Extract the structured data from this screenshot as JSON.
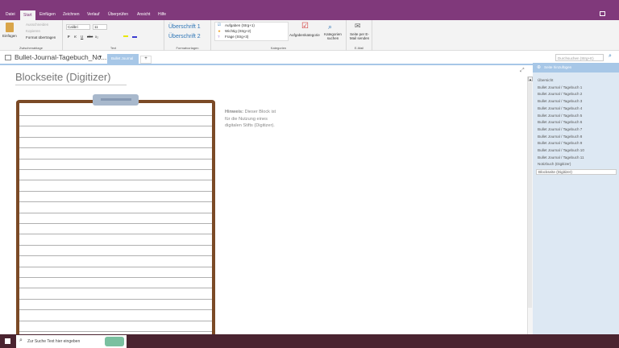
{
  "ribbon_tabs": [
    "Datei",
    "Start",
    "Einfügen",
    "Zeichnen",
    "Verlauf",
    "Überprüfen",
    "Ansicht",
    "Hilfe"
  ],
  "active_tab": "Start",
  "clipboard": {
    "paste": "Einfügen",
    "cut": "Ausschneiden",
    "copy": "Kopieren",
    "format_painter": "Format übertragen",
    "label": "Zwischenablage"
  },
  "text": {
    "font": "Calibri",
    "size": "11",
    "bold": "F",
    "italic": "K",
    "underline": "U",
    "strike": "abc",
    "sub": "x₂",
    "label": "Text"
  },
  "styles": {
    "h1": "Überschrift 1",
    "h2": "Überschrift 2",
    "label": "Formatvorlagen"
  },
  "tags": {
    "items": [
      "Aufgaben (Strg+1)",
      "Wichtig (Strg+2)",
      "Frage (Strg+3)"
    ],
    "todo_tag": "Aufgabenkategorie",
    "find_tags": "Kategorien suchen",
    "label": "Kategorien"
  },
  "email": {
    "send": "Seite per E-Mail senden",
    "label": "E-Mail"
  },
  "notebook": {
    "name": "Bullet-Journal-Tagebuch_No...",
    "section_tab": "Bullet Journal",
    "add_tab": "+"
  },
  "search": {
    "placeholder": "Durchsuchen (Strg+E)"
  },
  "page": {
    "title": "Blockseite (Digitizer)",
    "hint_bold": "Hinweis:",
    "hint_text": " Dieser Block ist für die Nutzung eines digitalen Stifts (Digitizer)."
  },
  "pages_panel": {
    "add_page": "Seite hinzufügen",
    "items": [
      "Übersicht",
      "Bullet Journal / Tagebuch 1",
      "Bullet Journal / Tagebuch 2",
      "Bullet Journal / Tagebuch 3",
      "Bullet Journal / Tagebuch 4",
      "Bullet Journal / Tagebuch 5",
      "Bullet Journal / Tagebuch 6",
      "Bullet Journal / Tagebuch 7",
      "Bullet Journal / Tagebuch 8",
      "Bullet Journal / Tagebuch 9",
      "Bullet Journal / Tagebuch 10",
      "Bullet Journal / Tagebuch 11",
      "Notizbuch (Digitizer)",
      "Blockseite (Digitizer)"
    ],
    "selected": "Blockseite (Digitizer)"
  },
  "taskbar": {
    "search_placeholder": "Zur Suche Text hier eingeben"
  },
  "colors": {
    "accent": "#80397b",
    "clipboard_frame": "#7b4a26",
    "taskbar": "#4a2430",
    "pages_bg": "#dde8f3"
  }
}
